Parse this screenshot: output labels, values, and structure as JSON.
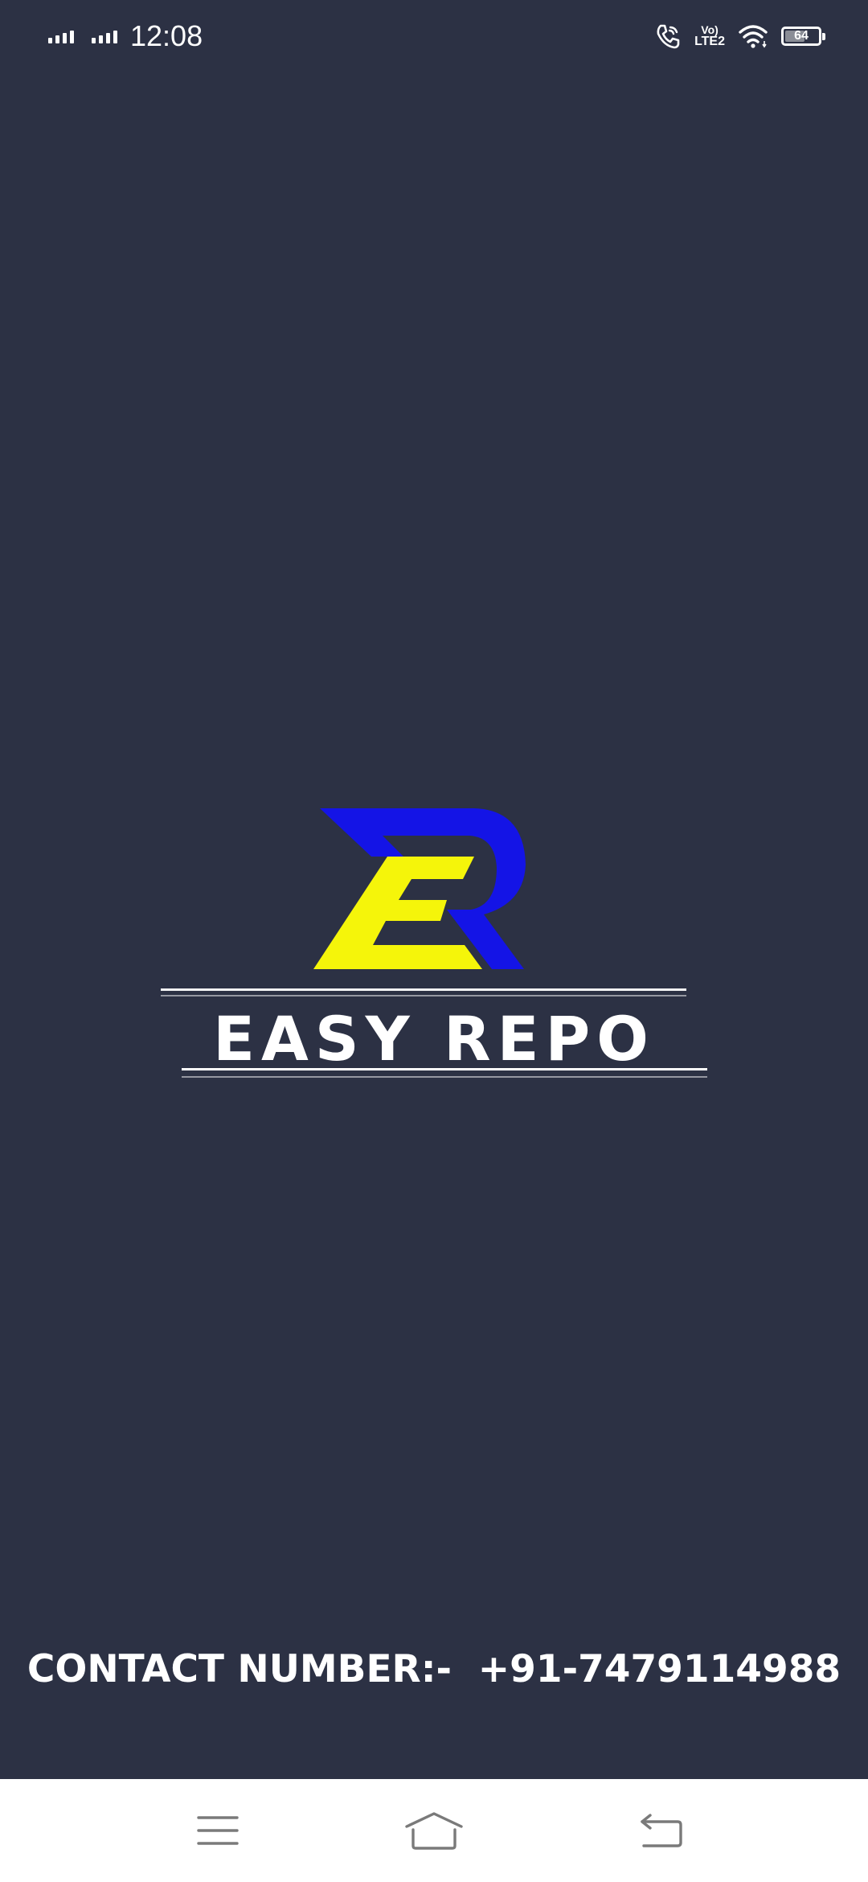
{
  "status_bar": {
    "time": "12:08",
    "battery_level": "64",
    "battery_fraction": 0.64,
    "network_label_top": "Vo)",
    "network_label_bottom": "LTE2",
    "icons": [
      "signal-sim1-icon",
      "signal-sim2-icon",
      "wifi-calling-icon",
      "volte-icon",
      "wifi-icon",
      "battery-icon"
    ]
  },
  "splash": {
    "brand_name": "EASY REPO",
    "logo_letters": "ER",
    "colors": {
      "background": "#2c3144",
      "logo_blue": "#1414e6",
      "logo_yellow": "#f5f50a",
      "text": "#ffffff"
    }
  },
  "footer": {
    "contact_text": "CONTACT NUMBER:-  +91-7479114988"
  },
  "nav_bar": {
    "buttons": [
      "menu-icon",
      "home-icon",
      "back-icon"
    ]
  }
}
